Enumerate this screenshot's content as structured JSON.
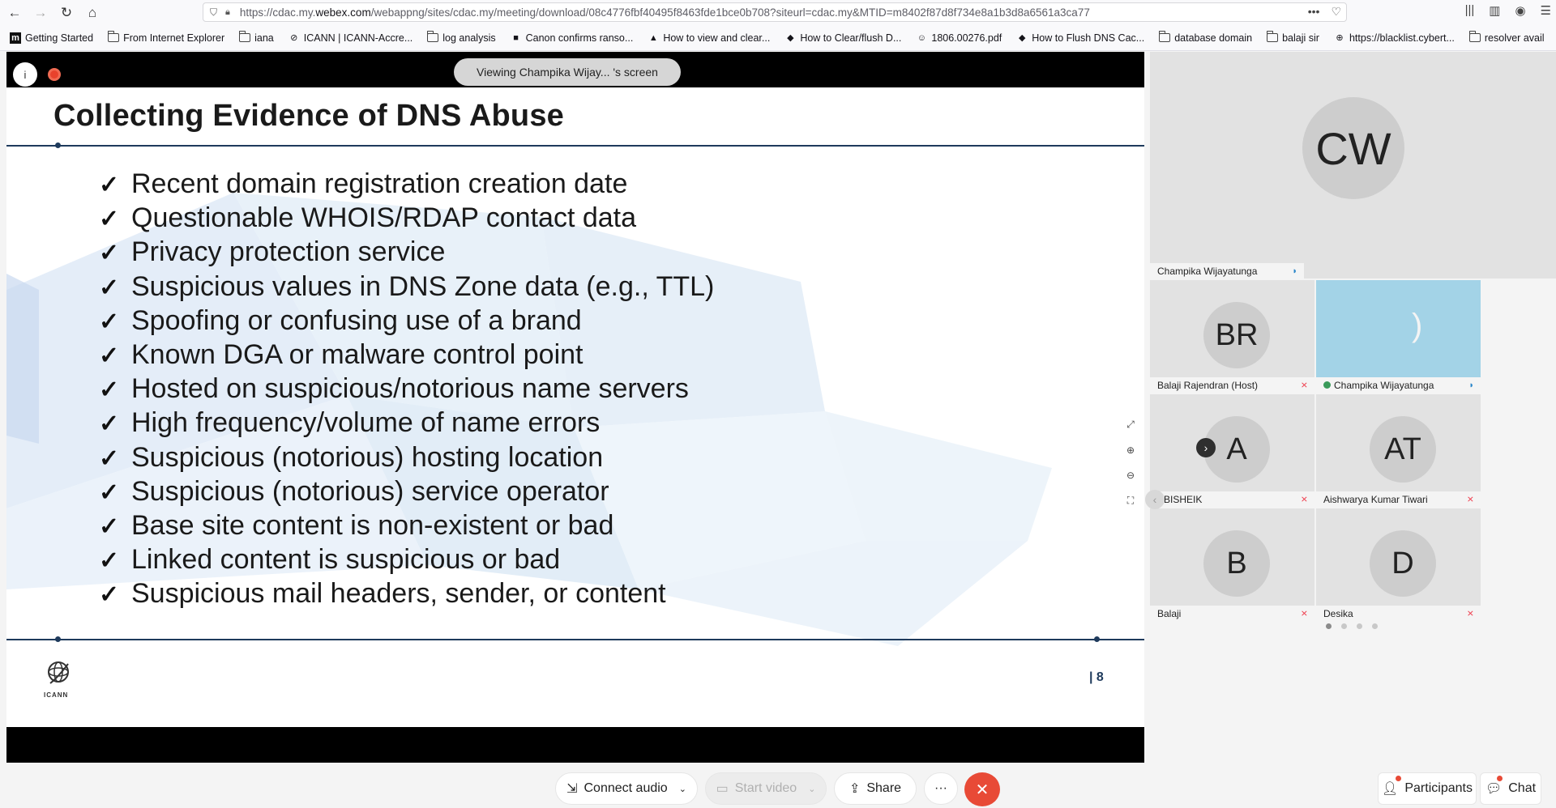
{
  "browser": {
    "url_prefix": "https://cdac.my.",
    "url_host": "webex.com",
    "url_rest": "/webappng/sites/cdac.my/meeting/download/08c4776fbf40495f8463fde1bce0b708?siteurl=cdac.my&MTID=m8402f87d8f734e8a1b3d8a6561a3ca77",
    "more_label": "•••",
    "bookmarks": [
      {
        "label": "Getting Started",
        "icon": "m-icon"
      },
      {
        "label": "From Internet Explorer",
        "icon": "folder-icon"
      },
      {
        "label": "iana",
        "icon": "folder-icon"
      },
      {
        "label": "ICANN | ICANN-Accre...",
        "icon": "icann-icon"
      },
      {
        "label": "log analysis",
        "icon": "folder-icon"
      },
      {
        "label": "Canon confirms ranso...",
        "icon": "canon-icon"
      },
      {
        "label": "How to view and clear...",
        "icon": "linux-icon"
      },
      {
        "label": "How to Clear/flush D...",
        "icon": "site-icon"
      },
      {
        "label": "1806.00276.pdf",
        "icon": "smile-icon"
      },
      {
        "label": "How to Flush DNS Cac...",
        "icon": "site-icon"
      },
      {
        "label": "database domain",
        "icon": "folder-icon"
      },
      {
        "label": "balaji sir",
        "icon": "folder-icon"
      },
      {
        "label": "https://blacklist.cybert...",
        "icon": "globe-icon"
      },
      {
        "label": "resolver avail",
        "icon": "folder-icon"
      }
    ]
  },
  "share": {
    "viewing_label": "Viewing Champika Wijay... 's screen"
  },
  "slide": {
    "title": "Collecting Evidence of DNS Abuse",
    "bullets": [
      "Recent domain registration creation date",
      "Questionable WHOIS/RDAP contact data",
      "Privacy protection service",
      "Suspicious values in DNS Zone data (e.g., TTL)",
      "Spoofing or confusing use of a brand",
      "Known DGA or malware control point",
      "Hosted on suspicious/notorious name servers",
      "High frequency/volume of name errors",
      "Suspicious (notorious) hosting location",
      "Suspicious (notorious) service operator",
      "Base site content is non-existent or bad",
      "Linked content is suspicious or bad",
      "Suspicious mail headers, sender, or content"
    ],
    "check_mark": "✓",
    "logo_text": "ICANN",
    "page_number": "| 8"
  },
  "participants": {
    "main": {
      "initials": "CW",
      "name": "Champika Wijayatunga"
    },
    "tiles": [
      {
        "initials": "BR",
        "name": "Balaji Rajendran (Host)",
        "muted": true
      },
      {
        "initials": "",
        "name": "Champika Wijayatunga",
        "muted": false,
        "speaking": true
      },
      {
        "initials": "A",
        "name": "ABISHEIK",
        "muted": true
      },
      {
        "initials": "AT",
        "name": "Aishwarya Kumar Tiwari",
        "muted": true
      },
      {
        "initials": "B",
        "name": "Balaji",
        "muted": true
      },
      {
        "initials": "D",
        "name": "Desika",
        "muted": true
      }
    ],
    "page_count": 4,
    "active_page": 0
  },
  "controls": {
    "connect_audio": "Connect audio",
    "start_video": "Start video",
    "share": "Share",
    "more": "···",
    "participants": "Participants",
    "chat": "Chat"
  },
  "colors": {
    "slide_rule": "#1e3a5c",
    "active_tile": "#a3d3e7",
    "end_button": "#e84a36"
  }
}
